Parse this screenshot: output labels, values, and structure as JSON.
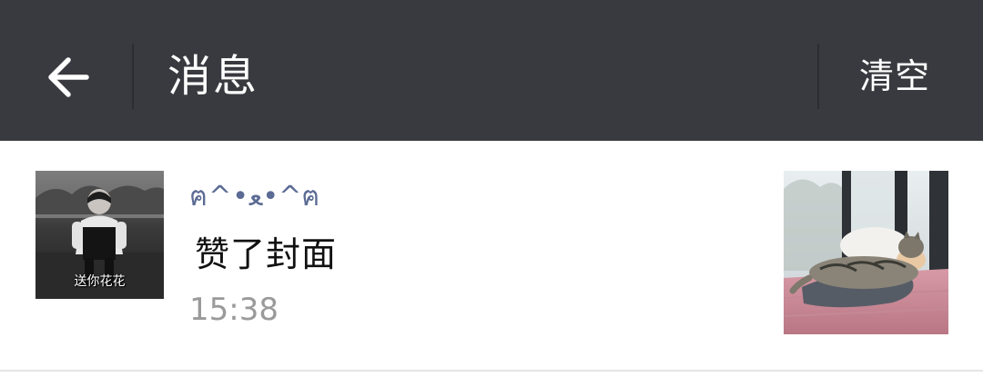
{
  "header": {
    "title": "消息",
    "clear_label": "清空",
    "colors": {
      "background": "#393a3f",
      "text": "#ffffff"
    }
  },
  "messages": [
    {
      "avatar_caption": "送你花花",
      "username": "ฅ^•ﻌ•^ฅ",
      "action": "赞了封面",
      "time": "15:38"
    }
  ]
}
